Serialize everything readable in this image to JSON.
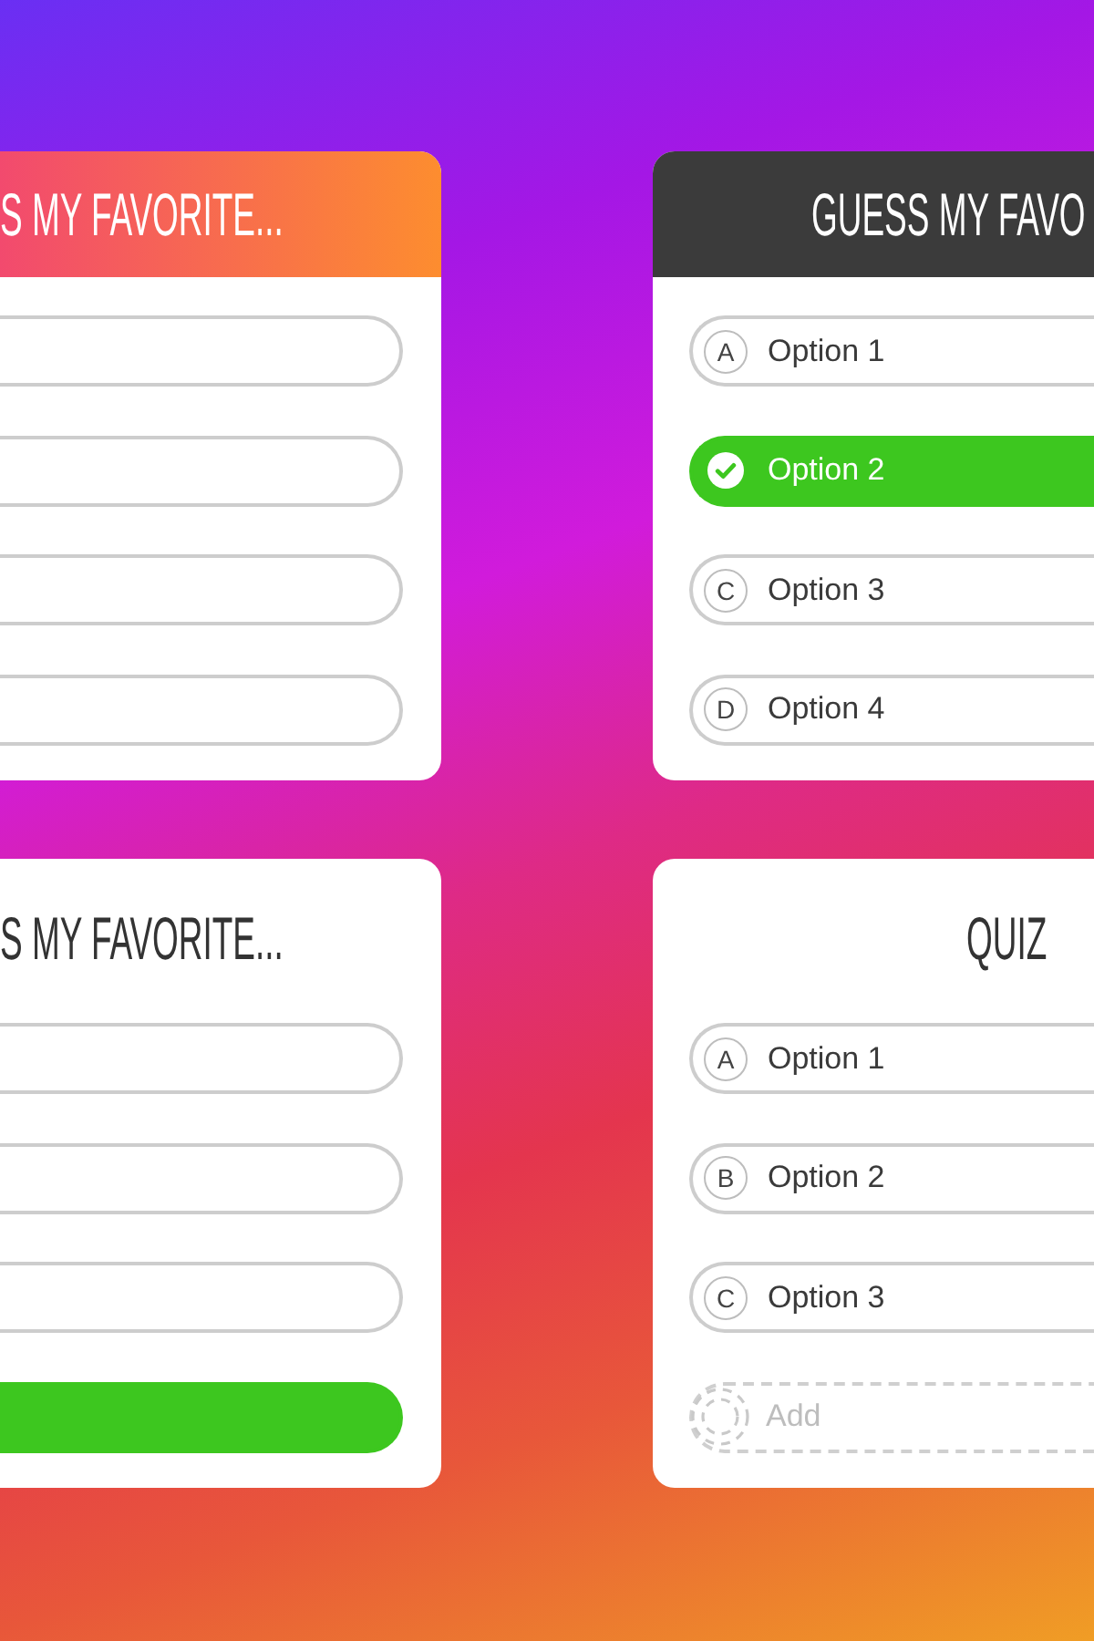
{
  "cards": [
    {
      "kind": "gradient",
      "title": "S MY FAVORITE...",
      "options": [
        {
          "kind": "option",
          "selected": false
        },
        {
          "kind": "option",
          "selected": false
        },
        {
          "kind": "option",
          "selected": false
        },
        {
          "kind": "option",
          "selected": false
        }
      ]
    },
    {
      "kind": "dark",
      "title": "GUESS MY FAVO",
      "options": [
        {
          "kind": "option",
          "letter": "A",
          "label": "Option 1",
          "selected": false
        },
        {
          "kind": "option",
          "label": "Option 2",
          "selected": true
        },
        {
          "kind": "option",
          "letter": "C",
          "label": "Option 3",
          "selected": false
        },
        {
          "kind": "option",
          "letter": "D",
          "label": "Option 4",
          "selected": false
        }
      ]
    },
    {
      "kind": "plain",
      "title": "S MY FAVORITE...",
      "options": [
        {
          "kind": "option",
          "selected": false
        },
        {
          "kind": "option",
          "selected": false
        },
        {
          "kind": "option",
          "selected": false
        },
        {
          "kind": "option",
          "selected": true
        }
      ]
    },
    {
      "kind": "plain",
      "title": "QUIZ",
      "options": [
        {
          "kind": "option",
          "letter": "A",
          "label": "Option 1",
          "selected": false
        },
        {
          "kind": "option",
          "letter": "B",
          "label": "Option 2",
          "selected": false
        },
        {
          "kind": "option",
          "letter": "C",
          "label": "Option 3",
          "selected": false
        },
        {
          "kind": "add",
          "label": "Add"
        }
      ]
    }
  ]
}
